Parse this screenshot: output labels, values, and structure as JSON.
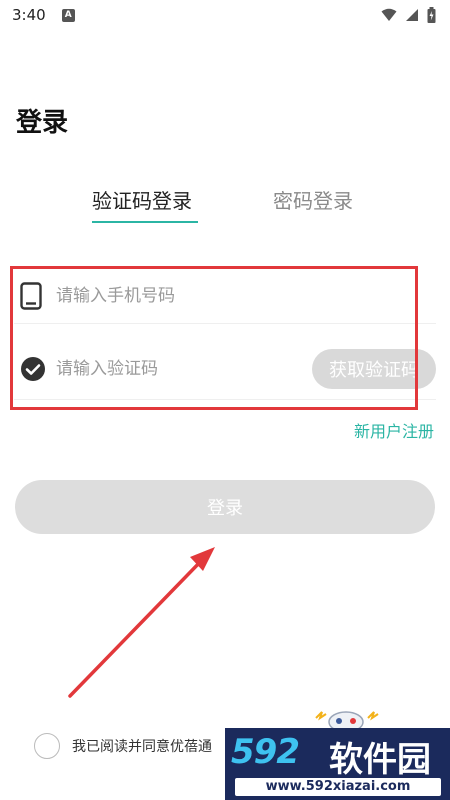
{
  "status_bar": {
    "time": "3:40",
    "notification_letter": "A",
    "icons": [
      "wifi-icon",
      "signal-icon",
      "battery-icon"
    ]
  },
  "page": {
    "title": "登录"
  },
  "tabs": [
    {
      "label": "验证码登录",
      "active": true
    },
    {
      "label": "密码登录",
      "active": false
    }
  ],
  "form": {
    "phone_placeholder": "请输入手机号码",
    "phone_icon": "phone-icon",
    "code_placeholder": "请输入验证码",
    "code_icon": "check-circle-icon",
    "get_code_label": "获取验证码"
  },
  "register_link": "新用户注册",
  "login_button": "登录",
  "agreement": {
    "text": "我已阅读并同意优蓓通"
  },
  "watermark": {
    "brand_number": "592",
    "brand_text": "软件园",
    "url": "www.592xiazai.com"
  },
  "colors": {
    "accent": "#2bb5a4",
    "annotation_red": "#e2383b",
    "button_disabled": "#dddddd"
  }
}
